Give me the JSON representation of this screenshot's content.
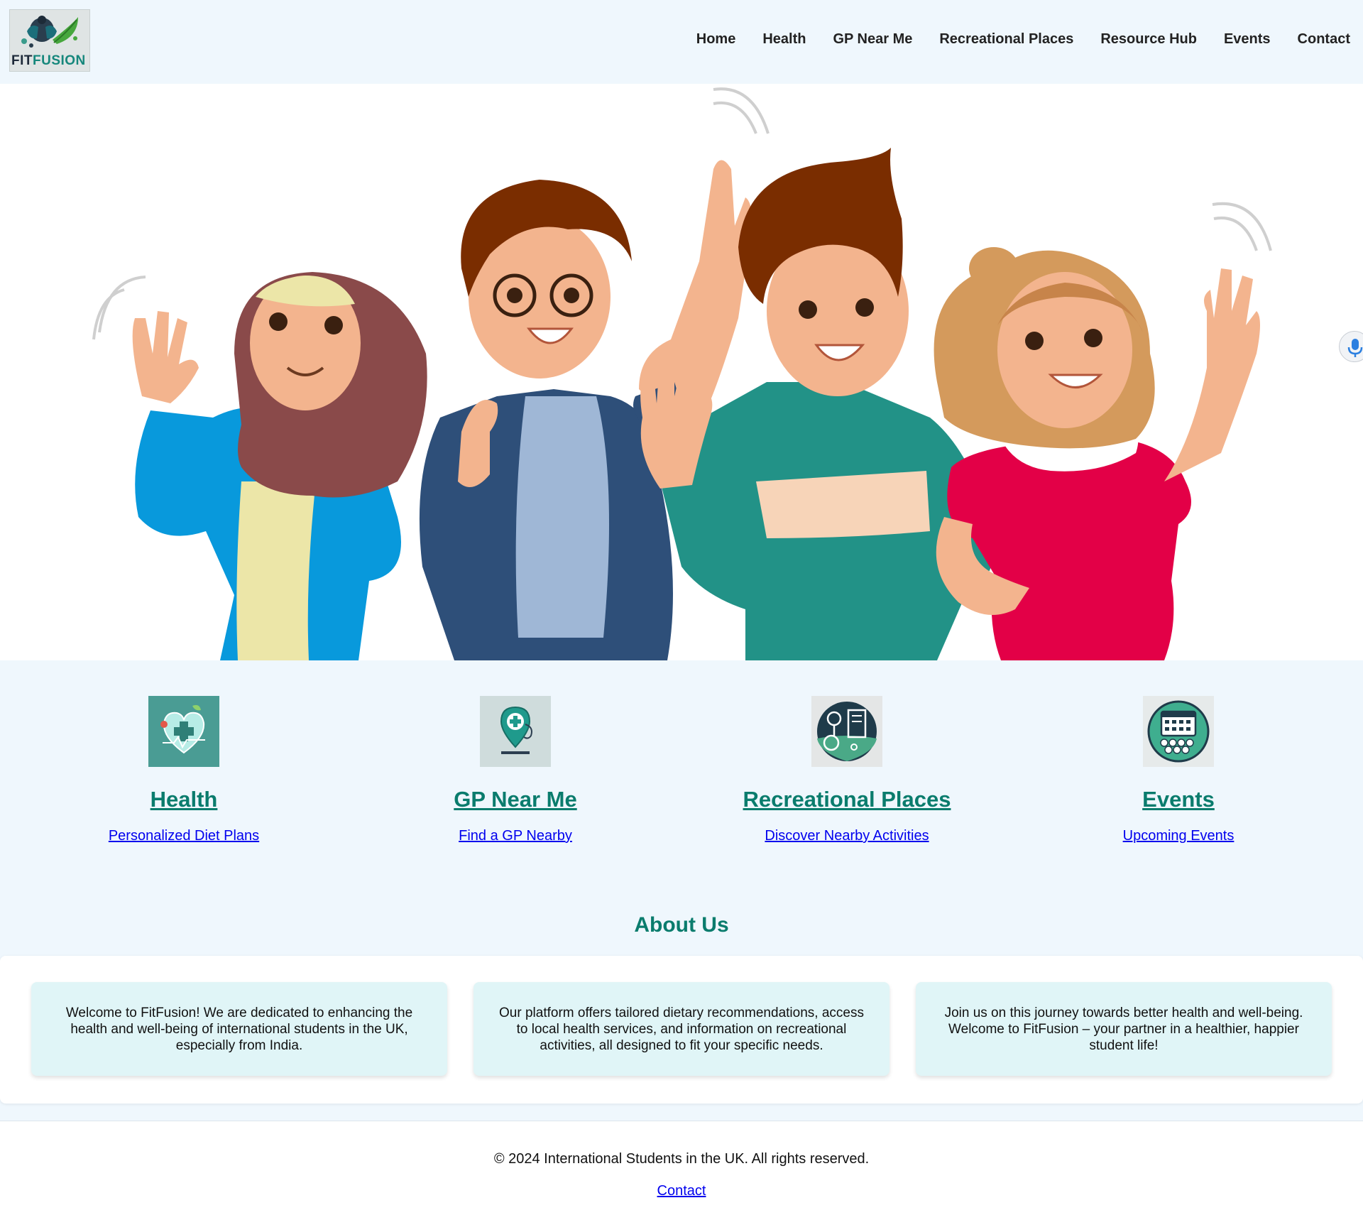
{
  "brand": {
    "word1": "FIT",
    "word2": "FUSION"
  },
  "nav": [
    "Home",
    "Health",
    "GP Near Me",
    "Recreational Places",
    "Resource Hub",
    "Events",
    "Contact"
  ],
  "hero": {
    "illustration": "four-waving-students-illustration"
  },
  "features": [
    {
      "icon": "heart-health-icon",
      "title": "Health",
      "link": "Personalized Diet Plans",
      "color": "#4a9c94"
    },
    {
      "icon": "gp-location-pin-icon",
      "title": "GP Near Me",
      "link": "Find a GP Nearby",
      "color": "#cfdcdc"
    },
    {
      "icon": "recreation-park-icon",
      "title": "Recreational Places",
      "link": "Discover Nearby Activities",
      "color": "#e4e6e6"
    },
    {
      "icon": "events-calendar-icon",
      "title": "Events",
      "link": "Upcoming Events",
      "color": "#e6eaea"
    }
  ],
  "about": {
    "title": "About Us",
    "cards": [
      "Welcome to FitFusion! We are dedicated to enhancing the health and well-being of international students in the UK, especially from India.",
      "Our platform offers tailored dietary recommendations, access to local health services, and information on recreational activities, all designed to fit your specific needs.",
      "Join us on this journey towards better health and well-being. Welcome to FitFusion – your partner in a healthier, happier student life!"
    ]
  },
  "footer": {
    "copyright": "© 2024 International Students in the UK. All rights reserved.",
    "link": "Contact"
  },
  "colors": {
    "accent": "#0a7c6d",
    "link": "#0000ee",
    "page_bg": "#eff7fd",
    "card_bg": "#e0f5f7"
  }
}
